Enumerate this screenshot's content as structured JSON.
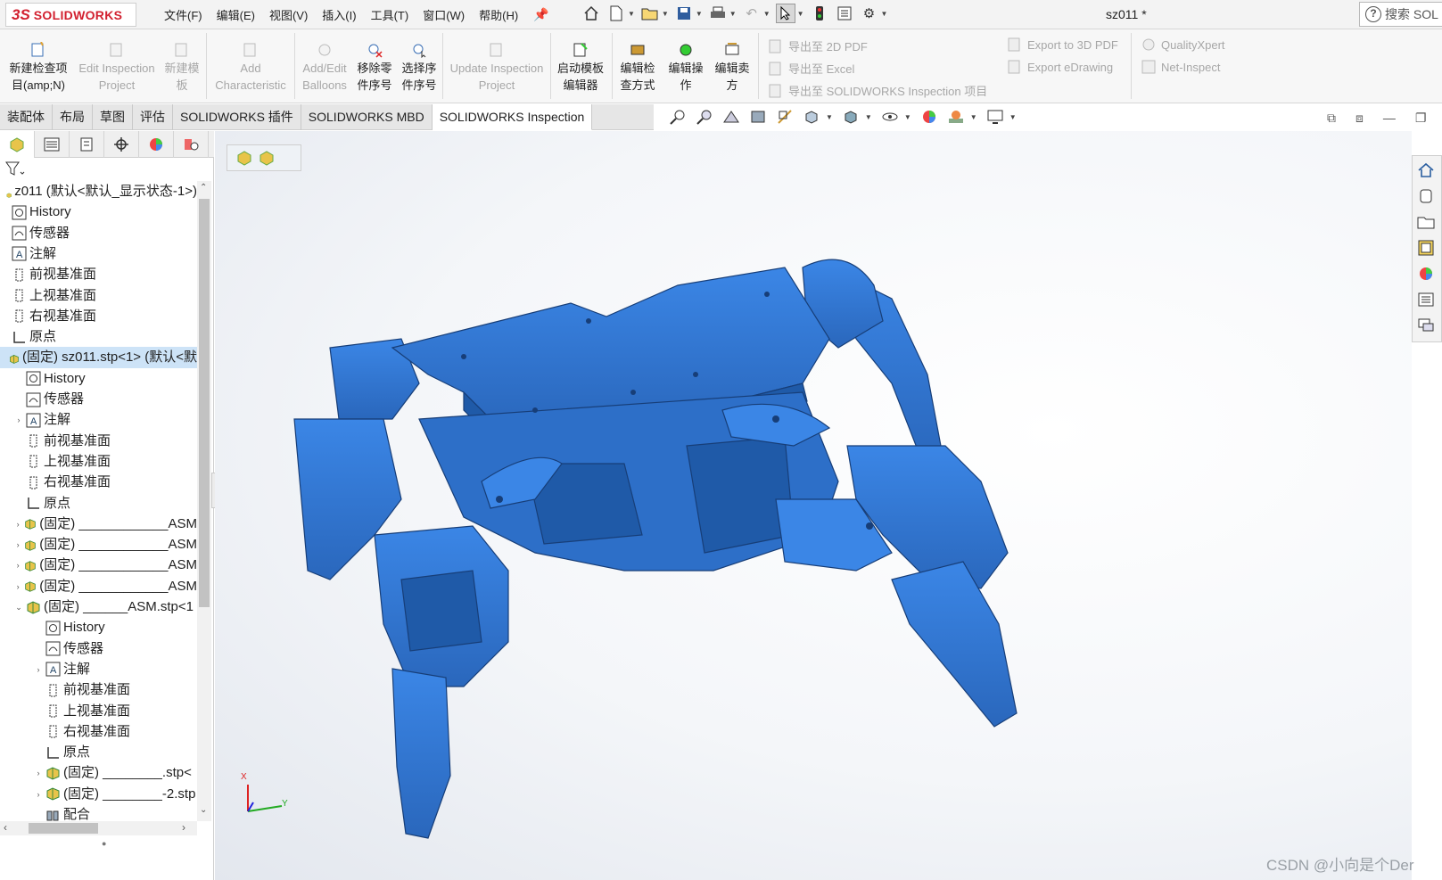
{
  "app": {
    "logo_ds": "3S",
    "logo_text": "SOLIDWORKS",
    "doc_title": "sz011 *",
    "search_placeholder": "搜索 SOL"
  },
  "menu": [
    "文件(F)",
    "编辑(E)",
    "视图(V)",
    "插入(I)",
    "工具(T)",
    "窗口(W)",
    "帮助(H)"
  ],
  "ribbon": {
    "buttons": [
      {
        "l1": "新建检查项",
        "l2": "目(amp;N)",
        "enabled": true
      },
      {
        "l1": "Edit Inspection",
        "l2": "Project",
        "enabled": false
      },
      {
        "l1": "新建模",
        "l2": "板",
        "enabled": false
      },
      {
        "l1": "Add",
        "l2": "Characteristic",
        "enabled": false
      },
      {
        "l1": "Add/Edit",
        "l2": "Balloons",
        "enabled": false
      },
      {
        "l1": "移除零",
        "l2": "件序号",
        "enabled": true
      },
      {
        "l1": "选择序",
        "l2": "件序号",
        "enabled": true
      },
      {
        "l1": "Update Inspection",
        "l2": "Project",
        "enabled": false
      },
      {
        "l1": "启动模板",
        "l2": "编辑器",
        "enabled": true
      },
      {
        "l1": "编辑检",
        "l2": "查方式",
        "enabled": true
      },
      {
        "l1": "编辑操",
        "l2": "作",
        "enabled": true
      },
      {
        "l1": "编辑卖",
        "l2": "方",
        "enabled": true
      }
    ],
    "exports": [
      "导出至 2D PDF",
      "导出至 Excel",
      "导出至 SOLIDWORKS Inspection 项目",
      "Export to 3D PDF",
      "Export eDrawing",
      "QualityXpert",
      "Net-Inspect"
    ]
  },
  "tabs": [
    "装配体",
    "布局",
    "草图",
    "评估",
    "SOLIDWORKS 插件",
    "SOLIDWORKS MBD",
    "SOLIDWORKS Inspection"
  ],
  "active_tab": "SOLIDWORKS Inspection",
  "tree": {
    "rows": [
      {
        "text": "z011  (默认<默认_显示状态-1>)",
        "icon": "assembly-root",
        "indent": 0,
        "tw": ""
      },
      {
        "text": "History",
        "icon": "history",
        "indent": 0,
        "tw": ""
      },
      {
        "text": "传感器",
        "icon": "sensor",
        "indent": 0,
        "tw": ""
      },
      {
        "text": "注解",
        "icon": "annotation",
        "indent": 0,
        "tw": ""
      },
      {
        "text": "前视基准面",
        "icon": "plane",
        "indent": 0,
        "tw": ""
      },
      {
        "text": "上视基准面",
        "icon": "plane",
        "indent": 0,
        "tw": ""
      },
      {
        "text": "右视基准面",
        "icon": "plane",
        "indent": 0,
        "tw": ""
      },
      {
        "text": "原点",
        "icon": "origin",
        "indent": 0,
        "tw": ""
      },
      {
        "text": "(固定) sz011.stp<1> (默认<默",
        "icon": "assembly",
        "indent": 0,
        "tw": "",
        "selected": true
      },
      {
        "text": "History",
        "icon": "history",
        "indent": 1,
        "tw": ""
      },
      {
        "text": "传感器",
        "icon": "sensor",
        "indent": 1,
        "tw": ""
      },
      {
        "text": "注解",
        "icon": "annotation",
        "indent": 1,
        "tw": "›"
      },
      {
        "text": "前视基准面",
        "icon": "plane",
        "indent": 1,
        "tw": ""
      },
      {
        "text": "上视基准面",
        "icon": "plane",
        "indent": 1,
        "tw": ""
      },
      {
        "text": "右视基准面",
        "icon": "plane",
        "indent": 1,
        "tw": ""
      },
      {
        "text": "原点",
        "icon": "origin",
        "indent": 1,
        "tw": ""
      },
      {
        "text": "(固定) ____________ASM",
        "icon": "assembly",
        "indent": 1,
        "tw": "›"
      },
      {
        "text": "(固定) ____________ASM",
        "icon": "assembly",
        "indent": 1,
        "tw": "›"
      },
      {
        "text": "(固定) ____________ASM",
        "icon": "assembly",
        "indent": 1,
        "tw": "›"
      },
      {
        "text": "(固定) ____________ASM",
        "icon": "assembly",
        "indent": 1,
        "tw": "›"
      },
      {
        "text": "(固定) ______ASM.stp<1",
        "icon": "assembly",
        "indent": 1,
        "tw": "⌄"
      },
      {
        "text": "History",
        "icon": "history",
        "indent": 2,
        "tw": ""
      },
      {
        "text": "传感器",
        "icon": "sensor",
        "indent": 2,
        "tw": ""
      },
      {
        "text": "注解",
        "icon": "annotation",
        "indent": 2,
        "tw": "›"
      },
      {
        "text": "前视基准面",
        "icon": "plane",
        "indent": 2,
        "tw": ""
      },
      {
        "text": "上视基准面",
        "icon": "plane",
        "indent": 2,
        "tw": ""
      },
      {
        "text": "右视基准面",
        "icon": "plane",
        "indent": 2,
        "tw": ""
      },
      {
        "text": "原点",
        "icon": "origin",
        "indent": 2,
        "tw": ""
      },
      {
        "text": "(固定) ________.stp<",
        "icon": "assembly",
        "indent": 2,
        "tw": "›"
      },
      {
        "text": "(固定) ________-2.stp",
        "icon": "assembly",
        "indent": 2,
        "tw": "›"
      },
      {
        "text": "配合",
        "icon": "mates",
        "indent": 2,
        "tw": ""
      }
    ]
  },
  "triad": {
    "x_label": "X",
    "y_label": "Y"
  },
  "watermark": "CSDN @小向是个Der",
  "colors": {
    "model": "#2f78d6",
    "model_dark": "#1f5aa8",
    "accent": "#d2202f"
  }
}
